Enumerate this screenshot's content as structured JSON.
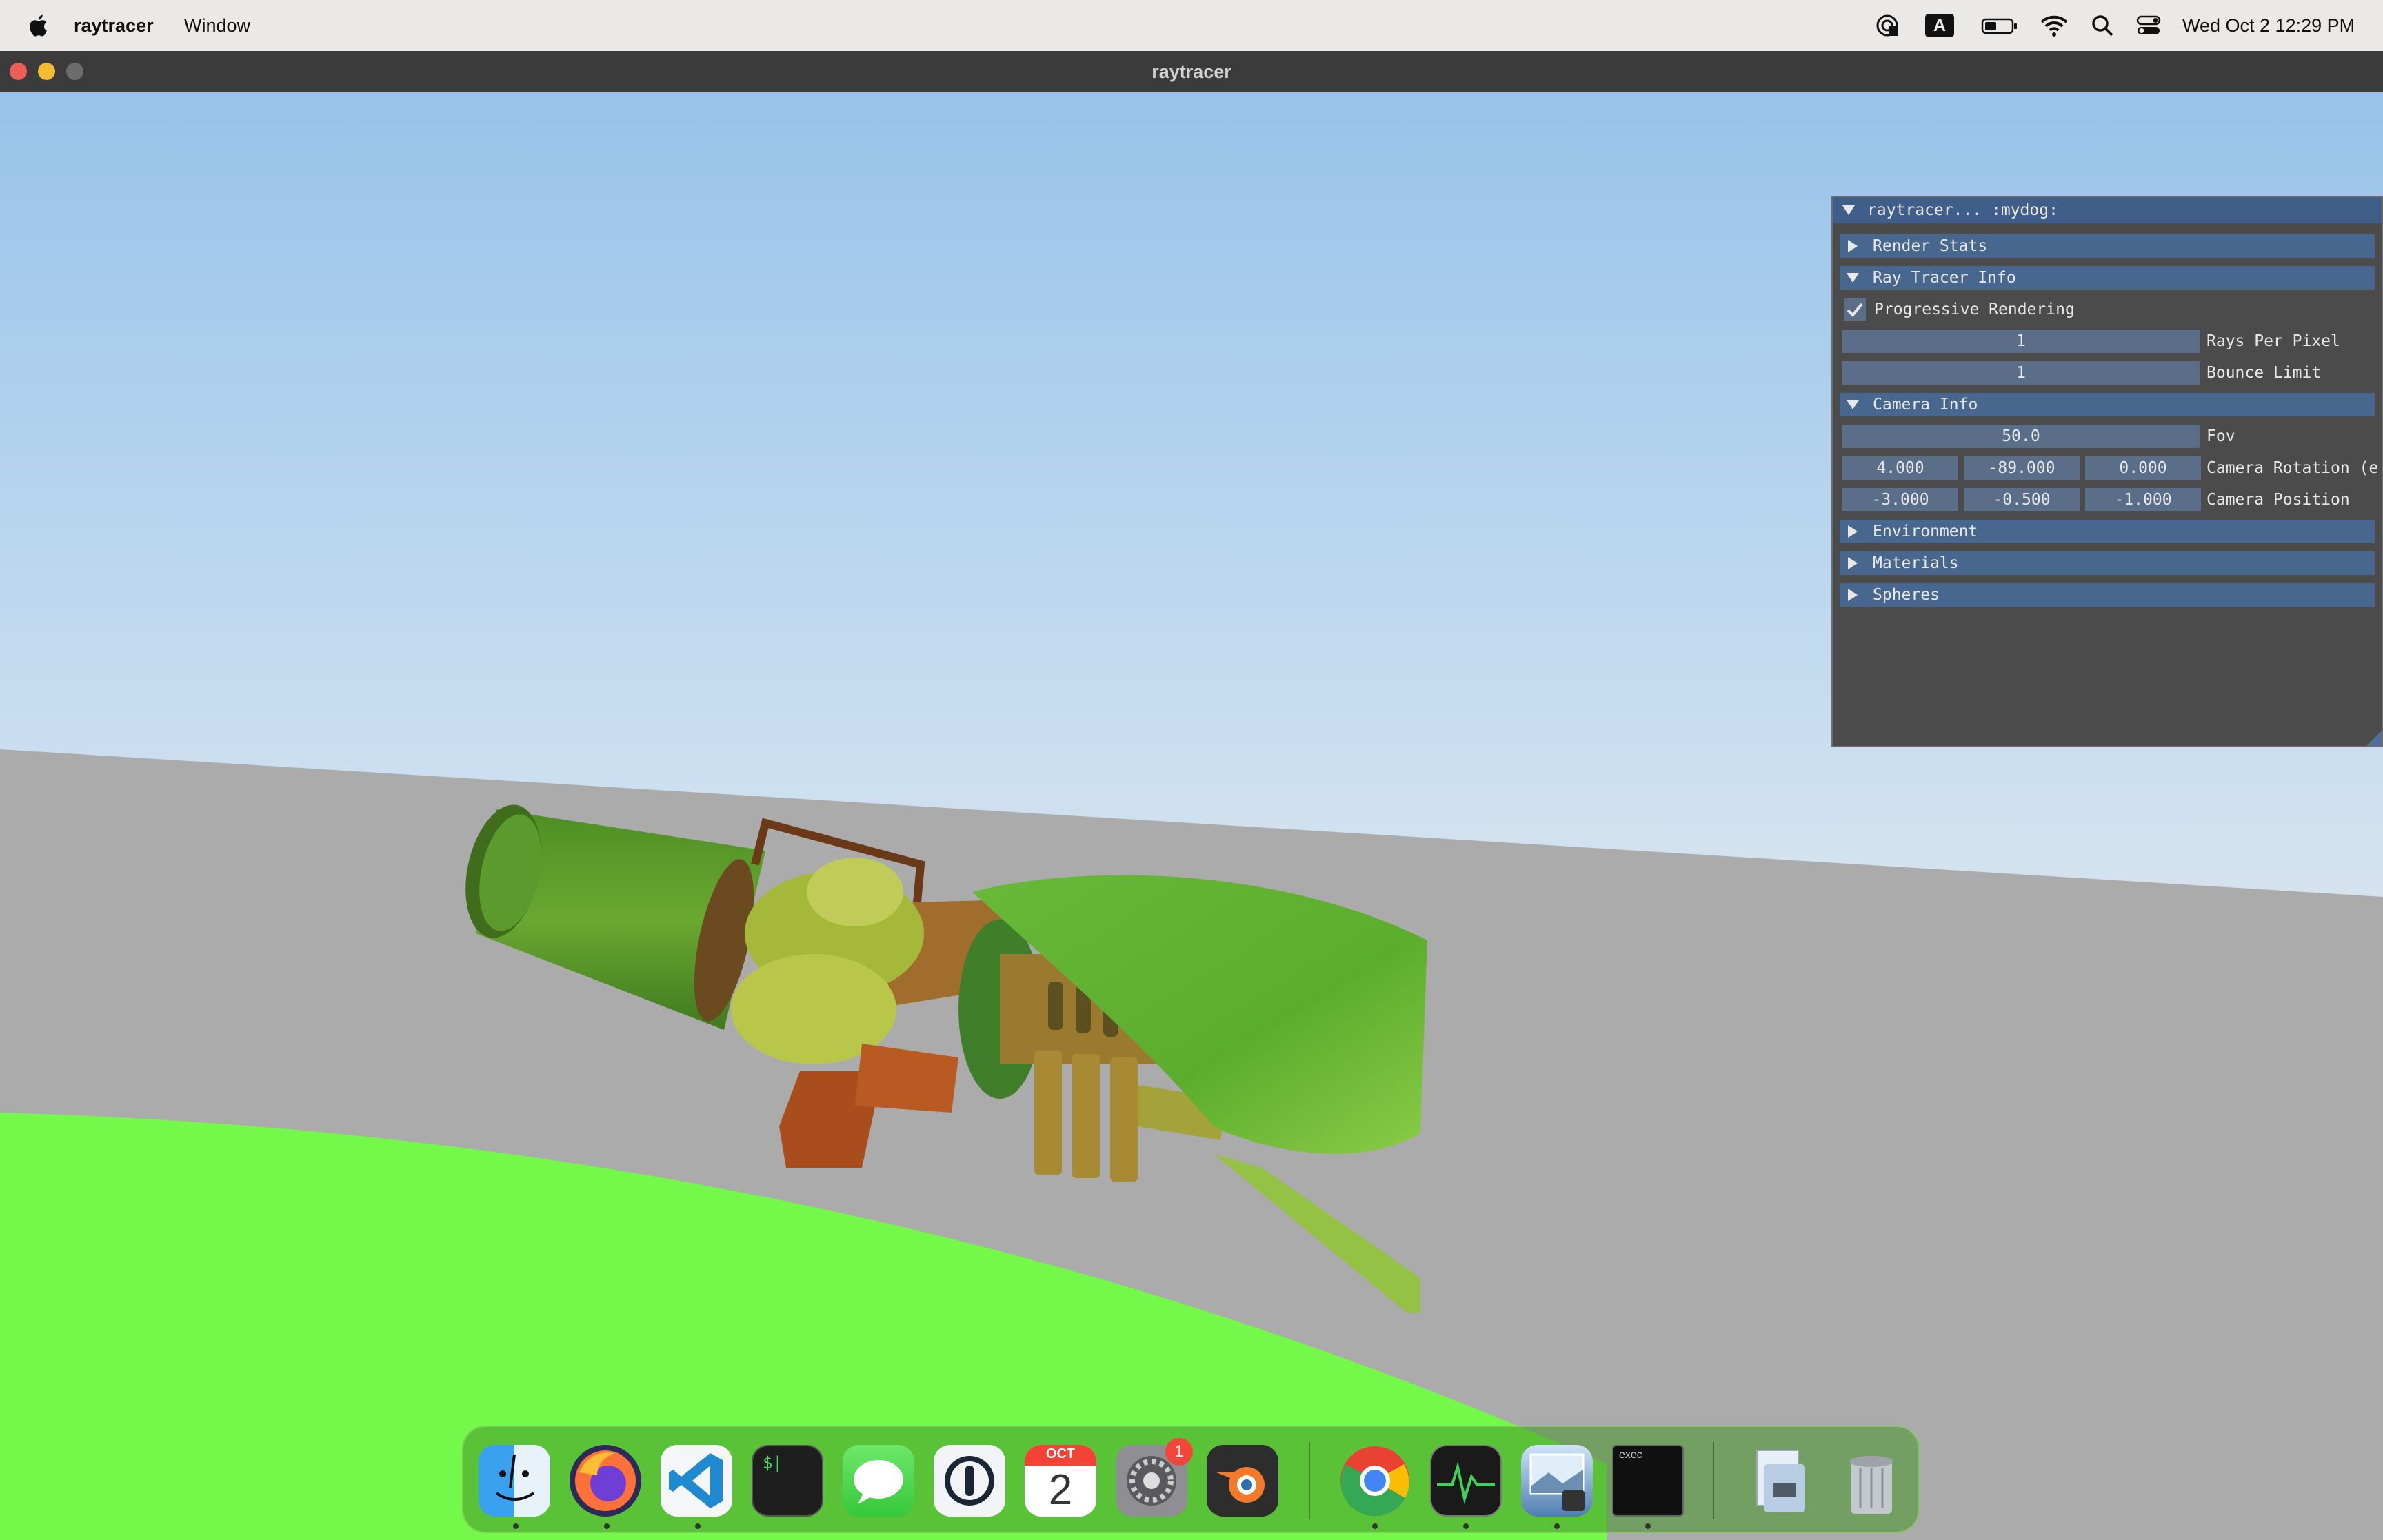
{
  "menubar": {
    "app_name": "raytracer",
    "menu_window": "Window",
    "datetime": "Wed Oct 2  12:29 PM",
    "keyboard_indicator": "A"
  },
  "window": {
    "title": "raytracer"
  },
  "panel": {
    "title": "raytracer... :mydog:",
    "render_stats": "Render Stats",
    "ray_tracer_info": "Ray Tracer Info",
    "progressive_label": "Progressive Rendering",
    "progressive_checked": true,
    "rays_per_pixel_value": "1",
    "rays_per_pixel_label": "Rays Per Pixel",
    "bounce_limit_value": "1",
    "bounce_limit_label": "Bounce Limit",
    "camera_info": "Camera Info",
    "fov_value": "50.0",
    "fov_label": "Fov",
    "camera_rotation": [
      "4.000",
      "-89.000",
      "0.000"
    ],
    "camera_rotation_label": "Camera Rotation (e",
    "camera_position": [
      "-3.000",
      "-0.500",
      "-1.000"
    ],
    "camera_position_label": "Camera Position",
    "environment": "Environment",
    "materials": "Materials",
    "spheres": "Spheres"
  },
  "dock": {
    "calendar_month": "OCT",
    "calendar_day": "2",
    "settings_badge": "1",
    "terminal_text": "$|",
    "exec_text": "exec"
  }
}
